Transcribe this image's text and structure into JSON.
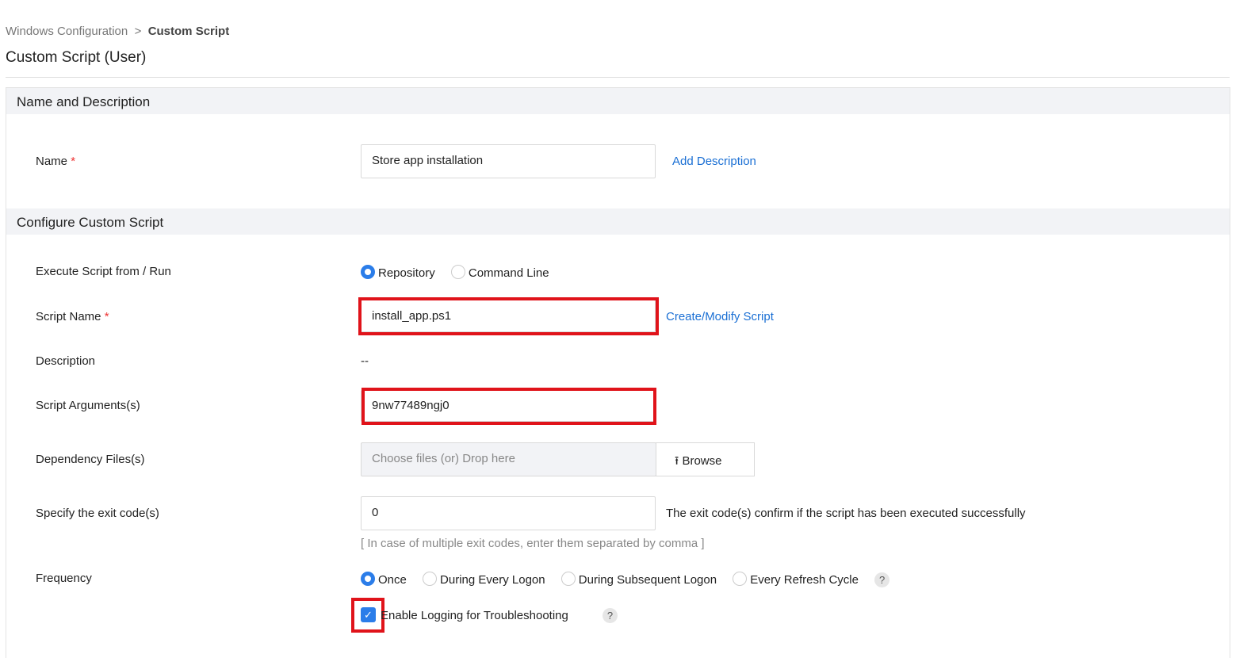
{
  "breadcrumb": {
    "parent": "Windows Configuration",
    "current": "Custom Script"
  },
  "page_title": "Custom Script (User)",
  "sections": {
    "name_desc": "Name and Description",
    "configure": "Configure Custom Script"
  },
  "name": {
    "label": "Name",
    "value": "Store app installation",
    "add_description": "Add Description"
  },
  "execute": {
    "label": "Execute Script from / Run",
    "options": [
      "Repository",
      "Command Line"
    ],
    "selected": "Repository"
  },
  "script_name": {
    "label": "Script Name",
    "value": "install_app.ps1",
    "link": "Create/Modify Script"
  },
  "description": {
    "label": "Description",
    "value": "--"
  },
  "arguments": {
    "label": "Script Arguments(s)",
    "value": "9nw77489ngj0"
  },
  "dependency": {
    "label": "Dependency Files(s)",
    "placeholder": "Choose files (or) Drop here",
    "browse": "Browse"
  },
  "exit_code": {
    "label": "Specify the exit code(s)",
    "value": "0",
    "info": "The exit code(s) confirm if the script has been executed successfully",
    "hint": "[ In case of multiple exit codes, enter them separated by comma ]"
  },
  "frequency": {
    "label": "Frequency",
    "options": [
      "Once",
      "During Every Logon",
      "During Subsequent Logon",
      "Every Refresh Cycle"
    ],
    "selected": "Once",
    "help": "?"
  },
  "logging": {
    "label": "Enable Logging for Troubleshooting",
    "checked": true,
    "help": "?"
  },
  "required_mark": "*"
}
